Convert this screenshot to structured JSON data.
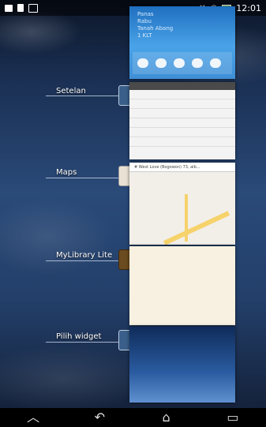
{
  "status_bar": {
    "time": "12:01"
  },
  "recent_apps": [
    {
      "label": "Setelan"
    },
    {
      "label": "Maps"
    },
    {
      "label": "MyLibrary Lite"
    },
    {
      "label": "Pilih widget"
    }
  ],
  "maps_search": "# West Love (Bogowon) 73, alb...",
  "navbar": {
    "back": "back",
    "home": "home",
    "recents": "recents",
    "up": "up"
  }
}
